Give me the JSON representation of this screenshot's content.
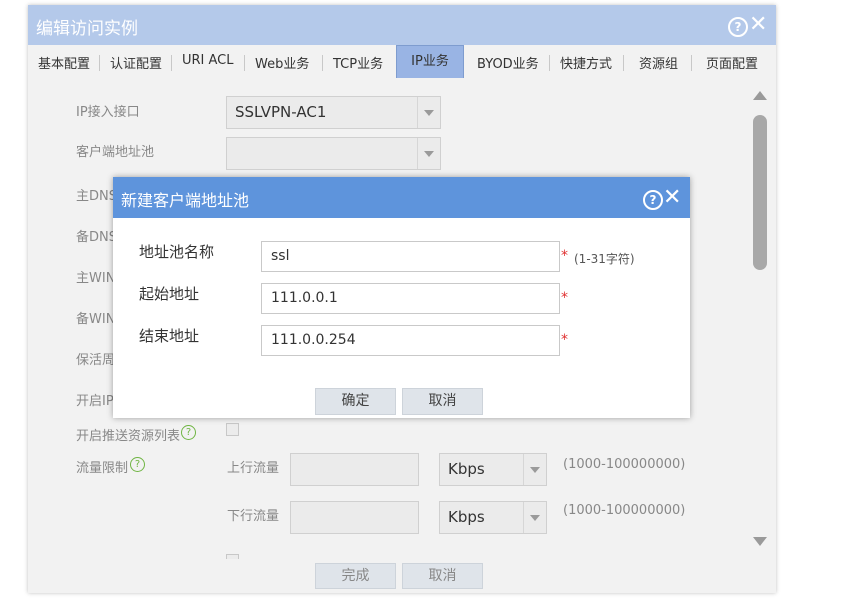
{
  "outer": {
    "title": "编辑访问实例",
    "help_glyph": "?",
    "close_glyph": "✕",
    "tabs": [
      {
        "label": "基本配置"
      },
      {
        "label": "认证配置"
      },
      {
        "label": "URI ACL"
      },
      {
        "label": "Web业务"
      },
      {
        "label": "TCP业务"
      },
      {
        "label": "IP业务"
      },
      {
        "label": "BYOD业务"
      },
      {
        "label": "快捷方式"
      },
      {
        "label": "资源组"
      },
      {
        "label": "页面配置"
      }
    ],
    "active_tab": "IP业务",
    "form": {
      "ip_interface_label": "IP接入接口",
      "ip_interface_value": "SSLVPN-AC1",
      "client_pool_label": "客户端地址池",
      "client_pool_value": "",
      "primary_dns_label": "主DNS",
      "backup_dns_label": "备DNS",
      "primary_wins_label": "主WIN",
      "backup_wins_label": "备WIN",
      "keepalive_label": "保活周",
      "enable_ip_label": "开启IP",
      "push_resource_label": "开启推送资源列表",
      "flow_limit_label": "流量限制",
      "uplink_label": "上行流量",
      "uplink_unit": "Kbps",
      "uplink_range": "(1000-100000000)",
      "downlink_label": "下行流量",
      "downlink_unit": "Kbps",
      "downlink_range": "(1000-100000000)"
    },
    "finish_label": "完成",
    "cancel_label": "取消"
  },
  "modal": {
    "title": "新建客户端地址池",
    "help_glyph": "?",
    "close_glyph": "✕",
    "pool_name_label": "地址池名称",
    "pool_name_value": "ssl",
    "pool_name_hint": "(1-31字符)",
    "start_addr_label": "起始地址",
    "start_addr_value": "111.0.0.1",
    "end_addr_label": "结束地址",
    "end_addr_value": "111.0.0.254",
    "required_mark": "*",
    "ok_label": "确定",
    "cancel_label": "取消"
  }
}
